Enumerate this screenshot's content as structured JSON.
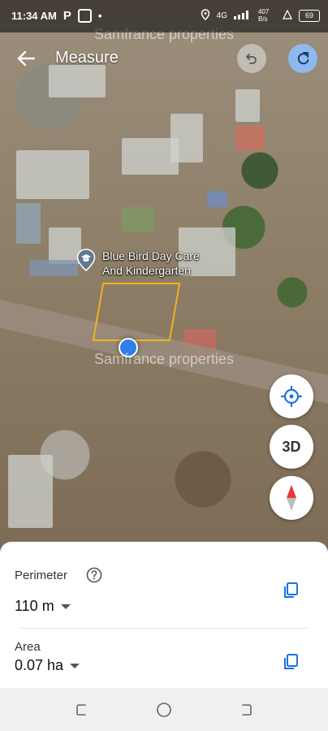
{
  "status_bar": {
    "time": "11:34 AM",
    "network": "4G",
    "speed": "407 B/s",
    "battery": "69"
  },
  "header": {
    "title": "Measure"
  },
  "map": {
    "watermark": "Samfrance properties",
    "poi_label_line1": "Blue Bird Day Care",
    "poi_label_line2": "And Kindergarten"
  },
  "map_controls": {
    "three_d_label": "3D"
  },
  "measurements": {
    "perimeter_label": "Perimeter",
    "perimeter_value": "110 m",
    "area_label": "Area",
    "area_value": "0.07 ha"
  },
  "colors": {
    "accent_blue": "#1a73e8",
    "parcel_outline": "#f3b31c",
    "location_dot": "#2f7dea"
  }
}
